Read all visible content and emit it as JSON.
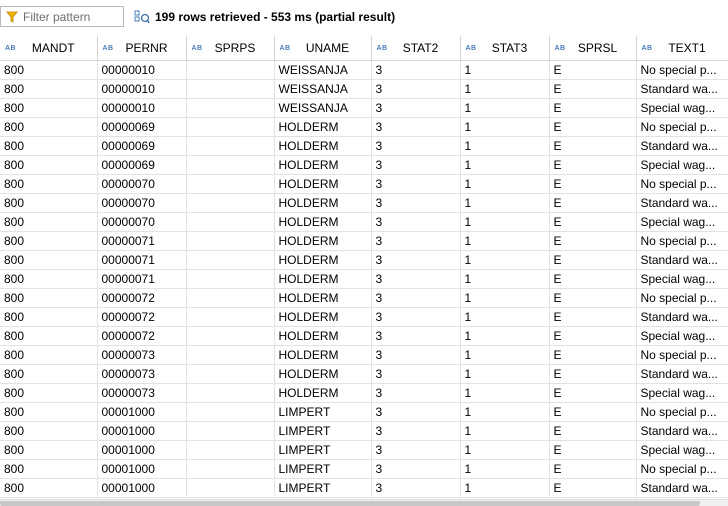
{
  "filter": {
    "placeholder": "Filter pattern"
  },
  "status": {
    "text": "199 rows retrieved - 553 ms (partial result)"
  },
  "table": {
    "columns": [
      "MANDT",
      "PERNR",
      "SPRPS",
      "UNAME",
      "STAT2",
      "STAT3",
      "SPRSL",
      "TEXT1"
    ],
    "type_marker": "AB",
    "rows": [
      [
        "800",
        "00000010",
        "",
        "WEISSANJA",
        "3",
        "1",
        "E",
        "No special p..."
      ],
      [
        "800",
        "00000010",
        "",
        "WEISSANJA",
        "3",
        "1",
        "E",
        "Standard wa..."
      ],
      [
        "800",
        "00000010",
        "",
        "WEISSANJA",
        "3",
        "1",
        "E",
        "Special wag..."
      ],
      [
        "800",
        "00000069",
        "",
        "HOLDERM",
        "3",
        "1",
        "E",
        "No special p..."
      ],
      [
        "800",
        "00000069",
        "",
        "HOLDERM",
        "3",
        "1",
        "E",
        "Standard wa..."
      ],
      [
        "800",
        "00000069",
        "",
        "HOLDERM",
        "3",
        "1",
        "E",
        "Special wag..."
      ],
      [
        "800",
        "00000070",
        "",
        "HOLDERM",
        "3",
        "1",
        "E",
        "No special p..."
      ],
      [
        "800",
        "00000070",
        "",
        "HOLDERM",
        "3",
        "1",
        "E",
        "Standard wa..."
      ],
      [
        "800",
        "00000070",
        "",
        "HOLDERM",
        "3",
        "1",
        "E",
        "Special wag..."
      ],
      [
        "800",
        "00000071",
        "",
        "HOLDERM",
        "3",
        "1",
        "E",
        "No special p..."
      ],
      [
        "800",
        "00000071",
        "",
        "HOLDERM",
        "3",
        "1",
        "E",
        "Standard wa..."
      ],
      [
        "800",
        "00000071",
        "",
        "HOLDERM",
        "3",
        "1",
        "E",
        "Special wag..."
      ],
      [
        "800",
        "00000072",
        "",
        "HOLDERM",
        "3",
        "1",
        "E",
        "No special p..."
      ],
      [
        "800",
        "00000072",
        "",
        "HOLDERM",
        "3",
        "1",
        "E",
        "Standard wa..."
      ],
      [
        "800",
        "00000072",
        "",
        "HOLDERM",
        "3",
        "1",
        "E",
        "Special wag..."
      ],
      [
        "800",
        "00000073",
        "",
        "HOLDERM",
        "3",
        "1",
        "E",
        "No special p..."
      ],
      [
        "800",
        "00000073",
        "",
        "HOLDERM",
        "3",
        "1",
        "E",
        "Standard wa..."
      ],
      [
        "800",
        "00000073",
        "",
        "HOLDERM",
        "3",
        "1",
        "E",
        "Special wag..."
      ],
      [
        "800",
        "00001000",
        "",
        "LIMPERT",
        "3",
        "1",
        "E",
        "No special p..."
      ],
      [
        "800",
        "00001000",
        "",
        "LIMPERT",
        "3",
        "1",
        "E",
        "Standard wa..."
      ],
      [
        "800",
        "00001000",
        "",
        "LIMPERT",
        "3",
        "1",
        "E",
        "Special wag..."
      ],
      [
        "800",
        "00001000",
        "",
        "LIMPERT",
        "3",
        "1",
        "E",
        "No special p..."
      ],
      [
        "800",
        "00001000",
        "",
        "LIMPERT",
        "3",
        "1",
        "E",
        "Standard wa..."
      ]
    ]
  },
  "icons": {
    "filter": "funnel-icon",
    "status": "rows-retrieved-icon"
  },
  "colors": {
    "funnel": "#f0b400",
    "type_marker": "#4a7bb7",
    "grid_line": "#e2e2e2"
  }
}
